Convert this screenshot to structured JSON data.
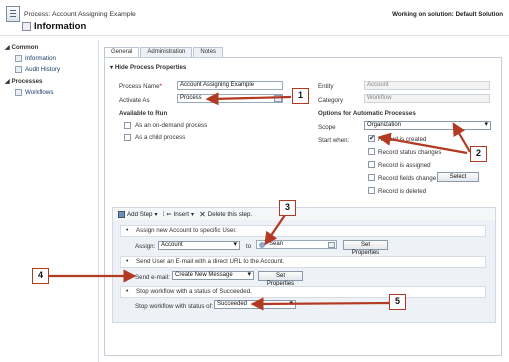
{
  "header": {
    "process_title": "Process: Account Assigning Example",
    "subtitle": "Information",
    "working_on": "Working on solution: Default Solution"
  },
  "sidebar": {
    "common_label": "Common",
    "common_items": [
      {
        "label": "Information"
      },
      {
        "label": "Audit History"
      }
    ],
    "processes_label": "Processes",
    "process_items": [
      {
        "label": "Workflows"
      }
    ]
  },
  "tabs": [
    {
      "label": "General"
    },
    {
      "label": "Administration"
    },
    {
      "label": "Notes"
    }
  ],
  "properties": {
    "section_title": "Hide Process Properties",
    "process_name_label": "Process Name",
    "process_name_value": "Account Assigning Example",
    "activate_as_label": "Activate As",
    "activate_as_value": "Process",
    "available_label": "Available to Run",
    "available_options": [
      {
        "label": "As an on-demand process",
        "checked": false
      },
      {
        "label": "As a child process",
        "checked": false
      }
    ],
    "entity_label": "Entity",
    "entity_value": "Account",
    "category_label": "Category",
    "category_value": "Workflow",
    "options_title": "Options for Automatic Processes",
    "scope_label": "Scope",
    "scope_value": "Organization",
    "start_when_label": "Start when:",
    "start_options": [
      {
        "label": "Record is created",
        "checked": true
      },
      {
        "label": "Record status changes",
        "checked": false
      },
      {
        "label": "Record is assigned",
        "checked": false
      },
      {
        "label": "Record fields change",
        "checked": false
      },
      {
        "label": "Record is deleted",
        "checked": false
      }
    ],
    "select_button": "Select"
  },
  "steps_toolbar": {
    "add_step": "Add Step",
    "insert": "Insert",
    "delete": "Delete this step."
  },
  "steps": {
    "step1_title": "Assign new Account to specific User.",
    "assign_label": "Assign:",
    "assign_value": "Account",
    "to_label": "to",
    "user_value": "Sean",
    "set_properties": "Set Properties",
    "step2_title": "Send User an E-mail with a direct URL to the Account.",
    "send_email_label": "Send e-mail:",
    "send_email_value": "Create New Message",
    "step3_title": "Stop workflow with a status of Succeeded.",
    "stop_label": "Stop workflow with status of:",
    "stop_value": "Succeeded"
  },
  "callouts": [
    "1",
    "2",
    "3",
    "4",
    "5"
  ],
  "colors": {
    "callout_border": "#b23a22",
    "arrow": "#b23a22",
    "link": "#1a3c6a"
  }
}
